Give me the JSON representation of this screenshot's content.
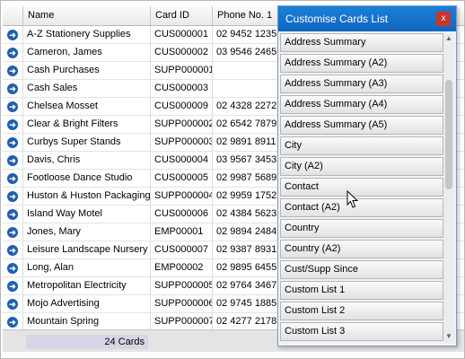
{
  "grid": {
    "columns": [
      "",
      "Name",
      "Card ID",
      "Phone No. 1"
    ],
    "rows": [
      {
        "name": "A-Z Stationery Supplies",
        "card_id": "CUS000001",
        "phone": "02 9452 1235"
      },
      {
        "name": "Cameron, James",
        "card_id": "CUS000002",
        "phone": "03 9546 2465"
      },
      {
        "name": "Cash Purchases",
        "card_id": "SUPP000001",
        "phone": ""
      },
      {
        "name": "Cash Sales",
        "card_id": "CUS000003",
        "phone": ""
      },
      {
        "name": "Chelsea Mosset",
        "card_id": "CUS000009",
        "phone": "02 4328 2272"
      },
      {
        "name": "Clear & Bright Filters",
        "card_id": "SUPP000002",
        "phone": "02 6542 7879"
      },
      {
        "name": "Curbys Super Stands",
        "card_id": "SUPP000003",
        "phone": "02 9891 8911"
      },
      {
        "name": "Davis, Chris",
        "card_id": "CUS000004",
        "phone": "03 9567 3453"
      },
      {
        "name": "Footloose Dance Studio",
        "card_id": "CUS000005",
        "phone": "02 9987 5689"
      },
      {
        "name": "Huston & Huston Packaging",
        "card_id": "SUPP000004",
        "phone": "02 9959 1752"
      },
      {
        "name": "Island Way Motel",
        "card_id": "CUS000006",
        "phone": "02 4384 5623"
      },
      {
        "name": "Jones, Mary",
        "card_id": "EMP00001",
        "phone": "02 9894 2484"
      },
      {
        "name": "Leisure Landscape Nursery",
        "card_id": "CUS000007",
        "phone": "02 9387 8931"
      },
      {
        "name": "Long, Alan",
        "card_id": "EMP00002",
        "phone": "02 9895 6455"
      },
      {
        "name": "Metropolitan Electricity",
        "card_id": "SUPP000005",
        "phone": "02 9764 3467"
      },
      {
        "name": "Mojo Advertising",
        "card_id": "SUPP000006",
        "phone": "02 9745 1885"
      },
      {
        "name": "Mountain Spring",
        "card_id": "SUPP000007",
        "phone": "02 4277 2178"
      }
    ],
    "count_label": "24 Cards",
    "row_icon": "arrow-circle-right-icon"
  },
  "panel": {
    "title": "Customise Cards List",
    "close_label": "x",
    "items": [
      "Address Summary",
      "Address Summary (A2)",
      "Address Summary (A3)",
      "Address Summary (A4)",
      "Address Summary (A5)",
      "City",
      "City (A2)",
      "Contact",
      "Contact (A2)",
      "Country",
      "Country (A2)",
      "Cust/Supp Since",
      "Custom List 1",
      "Custom List 2",
      "Custom List 3"
    ]
  },
  "colors": {
    "title_bar": "#1473cf",
    "close_button": "#c9362b",
    "row_icon": "#1f5fae"
  }
}
